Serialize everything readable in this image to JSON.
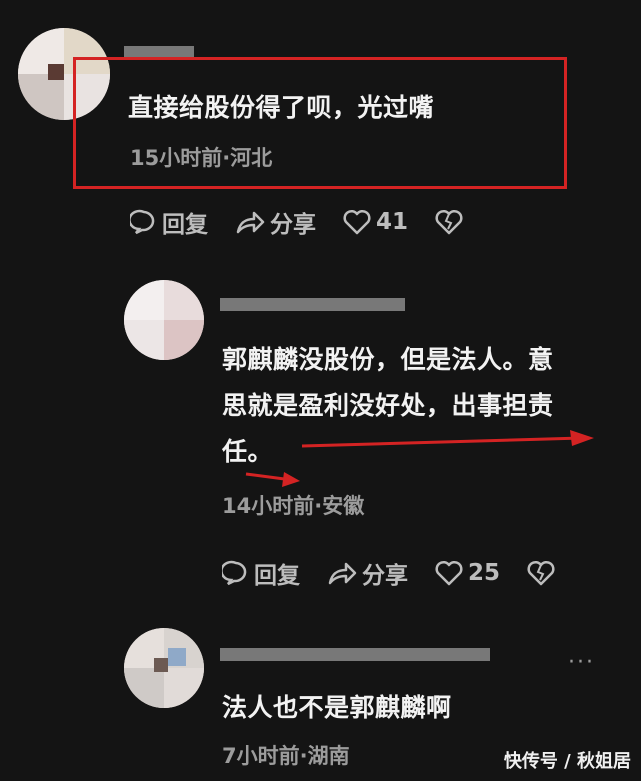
{
  "comments": [
    {
      "text": "直接给股份得了呗，光过嘴",
      "meta": "15小时前·河北",
      "reply_label": "回复",
      "share_label": "分享",
      "likes": "41"
    },
    {
      "text_line1": "郭麒麟没股份，但是法人。意",
      "text_line2": "思就是盈利没好处，出事担责",
      "text_line3": "任。",
      "meta": "14小时前·安徽",
      "reply_label": "回复",
      "share_label": "分享",
      "likes": "25"
    },
    {
      "text": "法人也不是郭麒麟啊",
      "meta": "7小时前·湖南",
      "more": "···"
    }
  ],
  "watermark": "快传号 / 秋姐居",
  "colors": {
    "highlight": "#d42323",
    "background": "#141414"
  }
}
